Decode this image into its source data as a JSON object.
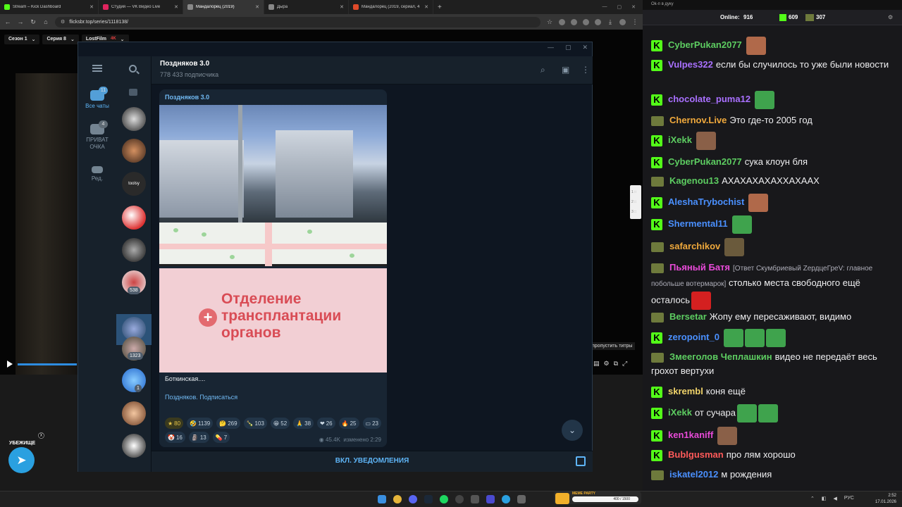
{
  "browser": {
    "tabs": [
      {
        "label": "Stream – Kick Dashboard",
        "color": "#53fc18"
      },
      {
        "label": "Студия — VK Видео Live",
        "color": "#e0245e"
      },
      {
        "label": "Мандалорец (2019)",
        "color": "#888888",
        "active": true
      },
      {
        "label": "Дыра",
        "color": "#888888"
      },
      {
        "label": "Мандалорец (2019, сериал, 4",
        "color": "#e04a2a"
      }
    ],
    "new_tab": "+",
    "url": "flicksbr.top/series/1118138/"
  },
  "player": {
    "season": "Сезон 1",
    "episode": "Серия 8",
    "studio": "LostFilm",
    "studio_badge": "4K",
    "skip_subs": "пропустить титры",
    "progress_fraction": 0.12
  },
  "scroll_indicator": [
    "1 ::",
    "2 ::",
    "3 ::"
  ],
  "tg_float": {
    "label": "УБЕЖИЩЕ",
    "close": "X"
  },
  "telegram": {
    "channel_title": "Поздняков 3.0",
    "subscribers": "778 433 подписчика",
    "folders": [
      {
        "label": "Все чаты",
        "badge": "11"
      },
      {
        "label": "ПРИВАТ ОЧКА",
        "badge": "4"
      },
      {
        "label": "Ред."
      }
    ],
    "chat_badges": [
      "538",
      "1323",
      "1"
    ],
    "message": {
      "from": "Поздняков 3.0",
      "sign_text": "Отделение трансплантации органов",
      "caption": "Боткинская....",
      "link": "Поздняков. Подписаться",
      "reactions": [
        {
          "emoji": "★",
          "count": "80",
          "gold": true
        },
        {
          "emoji": "🤣",
          "count": "1139"
        },
        {
          "emoji": "🤔",
          "count": "269"
        },
        {
          "emoji": "🍾",
          "count": "103"
        },
        {
          "emoji": "😁",
          "count": "52"
        },
        {
          "emoji": "🙏",
          "count": "38"
        },
        {
          "emoji": "❤",
          "count": "26"
        },
        {
          "emoji": "🔥",
          "count": "25"
        },
        {
          "emoji": "▭",
          "count": "23"
        },
        {
          "emoji": "🤡",
          "count": "16"
        },
        {
          "emoji": "🗿",
          "count": "13"
        },
        {
          "emoji": "💊",
          "count": "7"
        }
      ],
      "views": "45.4K",
      "edited": "изменено 2:29"
    },
    "notify_button": "ВКЛ. УВЕДОМЛЕНИЯ"
  },
  "chat": {
    "window_title": "Ok-п в дуку",
    "online_label": "Online:",
    "online_count": "916",
    "kick_count": "609",
    "other_count": "307",
    "messages": [
      {
        "user": "CyberPukan2077",
        "color": "#5dcd61",
        "badge": "k",
        "text": "",
        "emotes": [
          "#b0694a"
        ]
      },
      {
        "user": "Vulpes322",
        "color": "#a970ff",
        "badge": "k",
        "text": "если бы случилось то уже были новости",
        "emotes": []
      },
      {
        "user": "chocolate_puma12",
        "color": "#a970ff",
        "badge": "k",
        "text": "",
        "emotes": [
          "#3fa34d"
        ]
      },
      {
        "user": "Chernov.Live",
        "color": "#f0a93c",
        "badge": "p",
        "text": "Это где-то 2005 год",
        "emotes": []
      },
      {
        "user": "iXekk",
        "color": "#5dcd61",
        "badge": "k",
        "text": "",
        "emotes": [
          "#8a6048"
        ]
      },
      {
        "user": "CyberPukan2077",
        "color": "#5dcd61",
        "badge": "k",
        "text": "сука клоун бля",
        "emotes": []
      },
      {
        "user": "Kagenou13",
        "color": "#5dcd61",
        "badge": "p",
        "text": "АХАХАХАХАХХАХААХ",
        "emotes": []
      },
      {
        "user": "AleshaTrybochist",
        "color": "#4a90ff",
        "badge": "k",
        "text": "",
        "emotes": [
          "#b0694a"
        ]
      },
      {
        "user": "Shermental11",
        "color": "#4a90ff",
        "badge": "k",
        "text": "",
        "emotes": [
          "#3fa34d"
        ]
      },
      {
        "user": "safarchikov",
        "color": "#f0a93c",
        "badge": "p",
        "text": "",
        "emotes": [
          "#6a5a3c"
        ]
      },
      {
        "user": "Пьяный Батя",
        "color": "#e84ad8",
        "badge": "p",
        "reply": "[Ответ Скумбриевый ZердцеГреV: главное побольше вотермарок]",
        "text": "столько места свободного ещё осталось",
        "emotes": [
          "#d42020"
        ]
      },
      {
        "user": "Bersetar",
        "color": "#5dcd61",
        "badge": "p",
        "text": "Жопу ему пересаживают, видимо",
        "emotes": []
      },
      {
        "user": "zeropoint_0",
        "color": "#4a90ff",
        "badge": "k",
        "text": "",
        "emotes": [
          "#3fa34d",
          "#3fa34d",
          "#3fa34d"
        ]
      },
      {
        "user": "Змееголов Чеплашкин",
        "color": "#5dcd61",
        "badge": "p",
        "text": "видео не передаёт весь грохот вертухи",
        "emotes": []
      },
      {
        "user": "skrembl",
        "color": "#f0d36a",
        "badge": "k",
        "text": "коня ещё",
        "emotes": []
      },
      {
        "user": "iXekk",
        "color": "#5dcd61",
        "badge": "k",
        "text": "от сучара",
        "emotes": [
          "#3fa34d",
          "#3fa34d"
        ]
      },
      {
        "user": "ken1kaniff",
        "color": "#e84ad8",
        "badge": "k",
        "text": "",
        "emotes": [
          "#8a6048"
        ]
      },
      {
        "user": "Bublgusman",
        "color": "#ff5a5a",
        "badge": "k",
        "text": "про лям хорошо",
        "emotes": []
      },
      {
        "user": "iskatel2012",
        "color": "#4a90ff",
        "badge": "p",
        "text": "м рождения",
        "emotes": []
      }
    ]
  },
  "taskbar": {
    "meme_title": "MEME PARTY",
    "meme_progress": "400 / 1500",
    "lang": "РУС",
    "time": "2:52",
    "date": "17.01.2026"
  }
}
